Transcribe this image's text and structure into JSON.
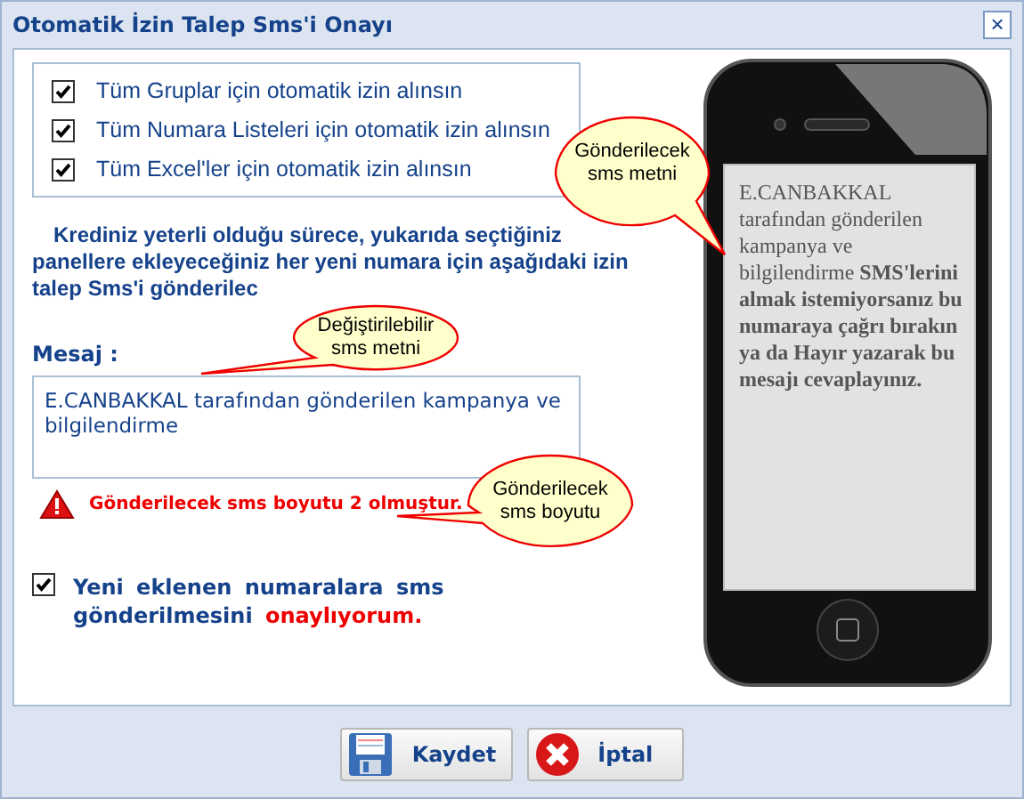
{
  "window": {
    "title": "Otomatik İzin Talep Sms'i Onayı",
    "close_label": "×"
  },
  "auto_permissions": [
    {
      "label": "Tüm Gruplar için otomatik izin alınsın",
      "checked": true
    },
    {
      "label": "Tüm Numara Listeleri için otomatik izin alınsın",
      "checked": true
    },
    {
      "label": "Tüm Excel'ler için otomatik izin alınsın",
      "checked": true
    }
  ],
  "info_text": "Krediniz yeterli olduğu sürece, yukarıda seçtiğiniz panellere ekleyeceğiniz her yeni numara için aşağıdaki izin talep Sms'i gönderilec",
  "message": {
    "label": "Mesaj :",
    "value": "E.CANBAKKAL tarafından gönderilen kampanya ve bilgilendirme"
  },
  "warning": "Gönderilecek sms boyutu 2 olmuştur.",
  "confirm": {
    "text": "Yeni eklenen numaralara sms gönderilmesini",
    "emphasis": "onaylıyorum.",
    "checked": true
  },
  "phone_preview": "E.CANBAKKAL tarafından gönderilen kampanya ve bilgilendirme **SMS'lerini almak istemiyorsanız bu numaraya çağrı bırakın ya da Hayır yazarak bu mesajı cevaplayınız.**",
  "callouts": [
    {
      "text": "Gönderilecek sms metni"
    },
    {
      "text": "Değiştirilebilir sms metni"
    },
    {
      "text": "Gönderilecek sms boyutu"
    }
  ],
  "buttons": [
    {
      "label": "Kaydet",
      "kind": "save"
    },
    {
      "label": "İptal",
      "kind": "cancel"
    }
  ]
}
